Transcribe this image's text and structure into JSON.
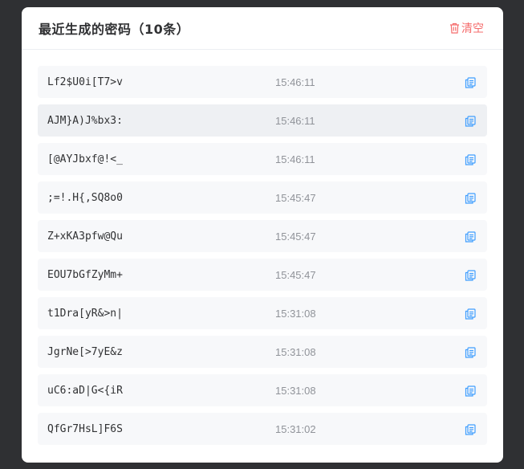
{
  "panel": {
    "title": "最近生成的密码（10条）",
    "clear_label": "清空",
    "clear_icon": "trash-icon",
    "copy_icon": "copy-icon",
    "accent_color": "#409eff",
    "danger_color": "#f56c6c"
  },
  "history": [
    {
      "password": "Lf2$U0i[T7>v",
      "time": "15:46:11"
    },
    {
      "password": "AJM}A)J%bx3:",
      "time": "15:46:11"
    },
    {
      "password": "[@AYJbxf@!<_",
      "time": "15:46:11"
    },
    {
      "password": ";=!.H{,SQ8o0",
      "time": "15:45:47"
    },
    {
      "password": "Z+xKA3pfw@Qu",
      "time": "15:45:47"
    },
    {
      "password": "EOU7bGfZyMm+",
      "time": "15:45:47"
    },
    {
      "password": "t1Dra[yR&>n|",
      "time": "15:31:08"
    },
    {
      "password": "JgrNe[>7yE&z",
      "time": "15:31:08"
    },
    {
      "password": "uC6:aD|G<{iR",
      "time": "15:31:08"
    },
    {
      "password": "QfGr7HsL]F6S",
      "time": "15:31:02"
    }
  ]
}
